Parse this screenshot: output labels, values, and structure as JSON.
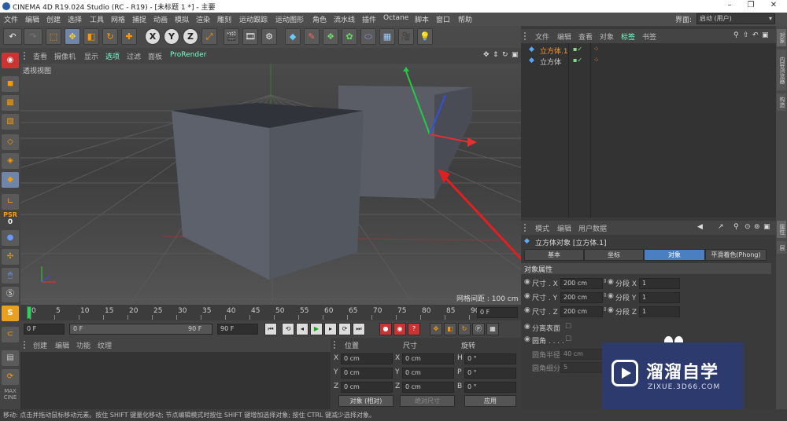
{
  "window": {
    "title": "CINEMA 4D R19.024 Studio (RC - R19) - [未标题 1 *] - 主要"
  },
  "menu": [
    "文件",
    "编辑",
    "创建",
    "选择",
    "工具",
    "网格",
    "捕捉",
    "动画",
    "模拟",
    "渲染",
    "雕刻",
    "运动跟踪",
    "运动图形",
    "角色",
    "流水线",
    "插件",
    "Octane",
    "脚本",
    "窗口",
    "帮助"
  ],
  "layout": {
    "label": "界面:",
    "value": "启动 (用户)"
  },
  "toolbar": {
    "axis_x": "X",
    "axis_y": "Y",
    "axis_z": "Z"
  },
  "lefttools": {
    "psr": "PSR",
    "psr_val": "0"
  },
  "viewport": {
    "menu": [
      "查看",
      "摄像机",
      "显示",
      "选项",
      "过滤",
      "面板",
      "ProRender"
    ],
    "name": "透视视图",
    "grid": "网格间距 : 100 cm"
  },
  "timeline": {
    "ticks": [
      "0",
      "5",
      "10",
      "15",
      "20",
      "25",
      "30",
      "35",
      "40",
      "45",
      "50",
      "55",
      "60",
      "65",
      "70",
      "75",
      "80",
      "85",
      "90"
    ],
    "frame_end": "0 F"
  },
  "playback": {
    "current": "0 F",
    "range_start": "0 F",
    "range_end": "90 F",
    "max": "90 F"
  },
  "materials": {
    "menu": [
      "创建",
      "编辑",
      "功能",
      "纹理"
    ]
  },
  "coords": {
    "headers": [
      "位置",
      "尺寸",
      "旋转"
    ],
    "rows": [
      {
        "a": "X",
        "av": "0 cm",
        "b": "X",
        "bv": "0 cm",
        "c": "H",
        "cv": "0 °"
      },
      {
        "a": "Y",
        "av": "0 cm",
        "b": "Y",
        "bv": "0 cm",
        "c": "P",
        "cv": "0 °"
      },
      {
        "a": "Z",
        "av": "0 cm",
        "b": "Z",
        "bv": "0 cm",
        "c": "B",
        "cv": "0 °"
      }
    ],
    "mode": "对象 (相对)",
    "size_mode": "绝对尺寸",
    "apply": "应用"
  },
  "objects": {
    "menu": [
      "文件",
      "编辑",
      "查看",
      "对象",
      "标签",
      "书签"
    ],
    "items": [
      {
        "name": "立方体.1",
        "selected": true
      },
      {
        "name": "立方体",
        "selected": false
      }
    ]
  },
  "attributes": {
    "menu": [
      "模式",
      "编辑",
      "用户数据"
    ],
    "title": "立方体对象 [立方体.1]",
    "tabs": [
      "基本",
      "坐标",
      "对象",
      "平滑着色(Phong)"
    ],
    "active_tab": "对象",
    "section": "对象属性",
    "rows": [
      {
        "label": "尺寸 . X",
        "value": "200 cm",
        "seg_label": "分段 X",
        "seg": "1"
      },
      {
        "label": "尺寸 . Y",
        "value": "200 cm",
        "seg_label": "分段 Y",
        "seg": "1"
      },
      {
        "label": "尺寸 . Z",
        "value": "200 cm",
        "seg_label": "分段 Z",
        "seg": "1"
      }
    ],
    "separate": "分离表面",
    "fillet": "圆角 . . . .",
    "fillet_radius_label": "圆角半径",
    "fillet_radius": "40 cm",
    "fillet_sub_label": "圆角细分",
    "fillet_sub": "5"
  },
  "sidetabs": [
    "对象",
    "内容浏览器",
    "构造",
    "属性",
    "层"
  ],
  "watermark": {
    "brand": "溜溜自学",
    "url": "ZIXUE.3D66.COM"
  },
  "status": "移动: 点击并拖动鼠标移动元素。按住 SHIFT 键量化移动; 节点编辑模式时按住 SHIFT 键增加选择对象; 按住 CTRL 键减少选择对象。",
  "colors": {
    "accent": "#4a7fc1",
    "axis_x": "#e03030",
    "axis_y": "#30c030",
    "axis_z": "#3050e0",
    "arrow": "#e02020"
  }
}
